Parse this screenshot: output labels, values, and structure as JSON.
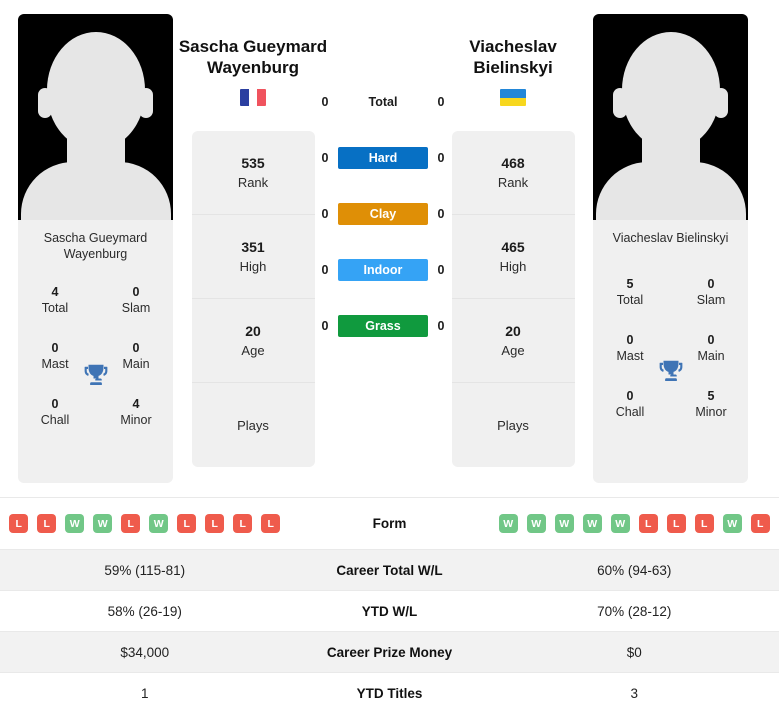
{
  "colors": {
    "win": "#71c787",
    "loss": "#ef5b4c",
    "hard": "#0770c4",
    "clay": "#df8f06",
    "indoor": "#35a3f5",
    "grass": "#109a3e",
    "trophy": "#3f74b5"
  },
  "left_player": {
    "name_line1": "Sascha Gueymard",
    "name_line2": "Wayenburg",
    "card_name": "Sascha Gueymard Wayenburg",
    "country": "France",
    "flag_type": "vertical",
    "flag_colors": [
      "#2b3fa0",
      "#ffffff",
      "#f0535e"
    ],
    "titles": {
      "total_value": "4",
      "total_label": "Total",
      "slam_value": "0",
      "slam_label": "Slam",
      "mast_value": "0",
      "mast_label": "Mast",
      "main_value": "0",
      "main_label": "Main",
      "chall_value": "0",
      "chall_label": "Chall",
      "minor_value": "4",
      "minor_label": "Minor"
    },
    "stats": [
      {
        "value": "535",
        "label": "Rank"
      },
      {
        "value": "351",
        "label": "High"
      },
      {
        "value": "20",
        "label": "Age"
      },
      {
        "value": "",
        "label": "Plays"
      }
    ],
    "surface_values": {
      "total": "0",
      "hard": "0",
      "clay": "0",
      "indoor": "0",
      "grass": "0"
    },
    "form": [
      "L",
      "L",
      "W",
      "W",
      "L",
      "W",
      "L",
      "L",
      "L",
      "L"
    ],
    "career_total_wl": "59% (115-81)",
    "ytd_wl": "58% (26-19)",
    "career_prize_money": "$34,000",
    "ytd_titles": "1"
  },
  "right_player": {
    "name_line1": "Viacheslav",
    "name_line2": "Bielinskyi",
    "card_name": "Viacheslav Bielinskyi",
    "country": "Ukraine",
    "flag_type": "horizontal",
    "flag_colors": [
      "#2387d8",
      "#f7d71e"
    ],
    "titles": {
      "total_value": "5",
      "total_label": "Total",
      "slam_value": "0",
      "slam_label": "Slam",
      "mast_value": "0",
      "mast_label": "Mast",
      "main_value": "0",
      "main_label": "Main",
      "chall_value": "0",
      "chall_label": "Chall",
      "minor_value": "5",
      "minor_label": "Minor"
    },
    "stats": [
      {
        "value": "468",
        "label": "Rank"
      },
      {
        "value": "465",
        "label": "High"
      },
      {
        "value": "20",
        "label": "Age"
      },
      {
        "value": "",
        "label": "Plays"
      }
    ],
    "surface_values": {
      "total": "0",
      "hard": "0",
      "clay": "0",
      "indoor": "0",
      "grass": "0"
    },
    "form": [
      "W",
      "W",
      "W",
      "W",
      "W",
      "L",
      "L",
      "L",
      "W",
      "L"
    ],
    "career_total_wl": "60% (94-63)",
    "ytd_wl": "70% (28-12)",
    "career_prize_money": "$0",
    "ytd_titles": "3"
  },
  "surfaces": {
    "total_label": "Total",
    "hard_label": "Hard",
    "clay_label": "Clay",
    "indoor_label": "Indoor",
    "grass_label": "Grass"
  },
  "table_labels": {
    "form": "Form",
    "career_total_wl": "Career Total W/L",
    "ytd_wl": "YTD W/L",
    "career_prize_money": "Career Prize Money",
    "ytd_titles": "YTD Titles"
  }
}
